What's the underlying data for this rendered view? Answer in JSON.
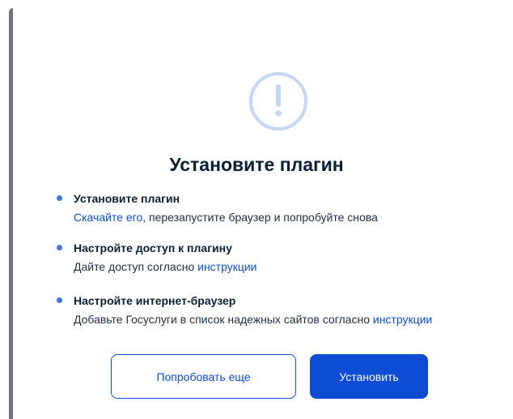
{
  "dialog": {
    "icon": "exclamation-circle-icon",
    "title": "Установите плагин",
    "steps": [
      {
        "title": "Установите плагин",
        "link_text": "Скачайте его",
        "desc_after": ", перезапустите браузер и попробуйте снова"
      },
      {
        "title": "Настройте доступ к плагину",
        "desc_before": "Дайте доступ согласно ",
        "link_text": "инструкции"
      },
      {
        "title": "Настройте интернет-браузер",
        "desc_before": "Добавьте Госуслуги в список надежных сайтов согласно ",
        "link_text": "инструкции"
      }
    ],
    "buttons": {
      "retry_label": "Попробовать еще",
      "install_label": "Установить"
    }
  },
  "colors": {
    "accent": "#0d4cd3",
    "bullet": "#4175d9",
    "icon": "#c6d6f5",
    "text": "#0b1f33"
  }
}
